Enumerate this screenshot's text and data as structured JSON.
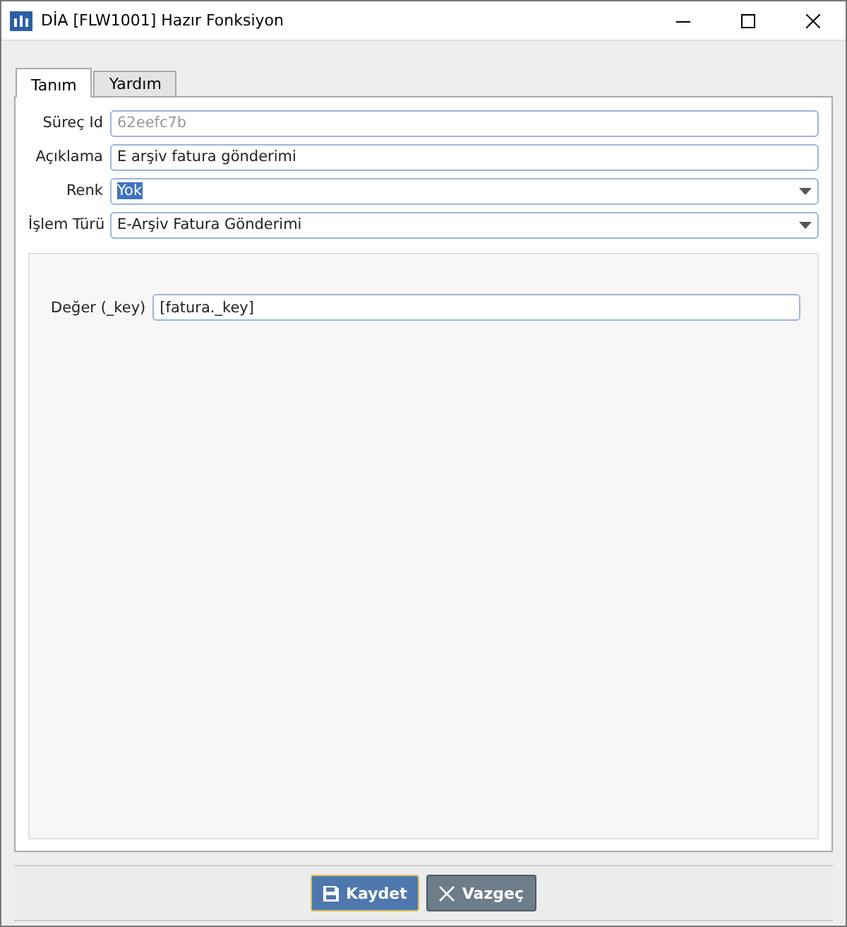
{
  "window": {
    "title": "DİA [FLW1001] Hazır Fonksiyon"
  },
  "tabs": [
    {
      "label": "Tanım",
      "selected": true
    },
    {
      "label": "Yardım",
      "selected": false
    }
  ],
  "fields": [
    {
      "label": "Süreç Id",
      "kind": "text",
      "value": "62eefc7b",
      "disabled": true,
      "highlighted": false
    },
    {
      "label": "Açıklama",
      "kind": "text",
      "value": "E arşiv fatura gönderimi",
      "disabled": false,
      "highlighted": false
    },
    {
      "label": "Renk",
      "kind": "dropdown",
      "value": "Yok",
      "disabled": false,
      "highlighted": true
    },
    {
      "label": "İşlem Türü",
      "kind": "dropdown",
      "value": "E-Arşiv Fatura Gönderimi",
      "disabled": false,
      "highlighted": false
    }
  ],
  "parameters": [
    {
      "label": "Değer (_key)",
      "value": "[fatura._key]"
    }
  ],
  "buttons": [
    {
      "label": "Kaydet",
      "kind": "primary"
    },
    {
      "label": "Vazgeç",
      "kind": "secondary"
    }
  ]
}
